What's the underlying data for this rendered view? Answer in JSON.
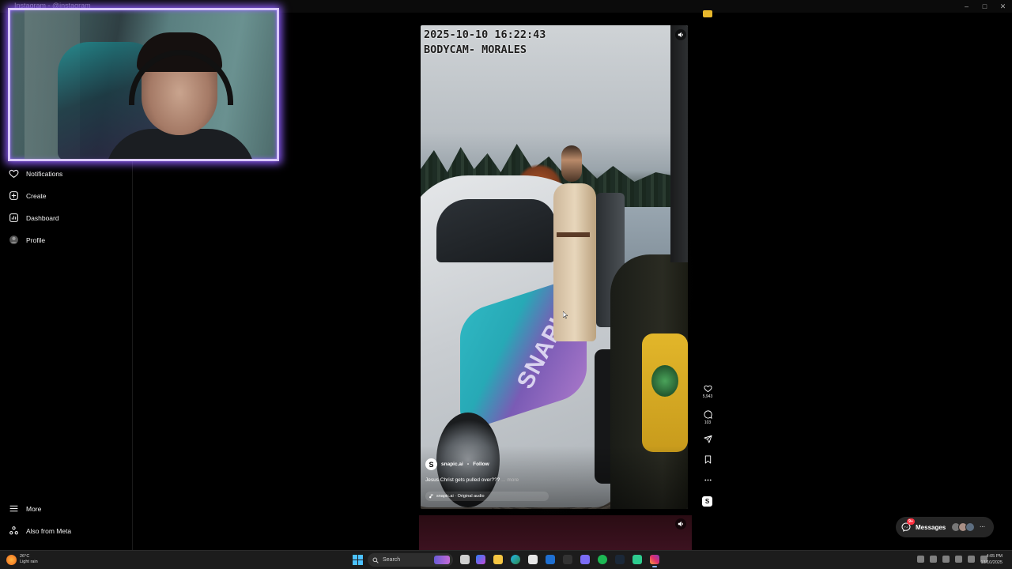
{
  "window": {
    "title": "Instagram - @instagram",
    "controls": [
      "–",
      "□",
      "✕"
    ]
  },
  "sidebar": {
    "items": [
      {
        "label": "Notifications",
        "icon": "heart-icon"
      },
      {
        "label": "Create",
        "icon": "plus-square-icon"
      },
      {
        "label": "Dashboard",
        "icon": "chart-icon"
      },
      {
        "label": "Profile",
        "icon": "avatar-icon"
      }
    ],
    "bottom": [
      {
        "label": "More",
        "icon": "hamburger-icon"
      },
      {
        "label": "Also from Meta",
        "icon": "meta-icon"
      }
    ]
  },
  "reel": {
    "timestamp": "2025-10-10 16:22:43",
    "camera": "BODYCAM- MORALES",
    "car_wrap_text": "SNAPIC.AI",
    "author": "snapic.ai",
    "author_initial": "S",
    "separator": "•",
    "follow": "Follow",
    "caption": "Jesus Christ gets pulled over???",
    "more": "... more",
    "audio": "snapic.ai · Original audio"
  },
  "actions": {
    "likes": "5,943",
    "comments": "103"
  },
  "messages": {
    "label": "Messages",
    "badge": "9+",
    "ellipsis": "···"
  },
  "taskbar": {
    "weather_temp": "26°C",
    "weather_desc": "Light rain",
    "search_placeholder": "Search",
    "time": "4:05 PM",
    "date": "13/10/2025"
  },
  "colors": {
    "webcam_glow": "#8f5dff",
    "notification_red": "#ff3040",
    "badge_gold": "#e2b62a"
  }
}
